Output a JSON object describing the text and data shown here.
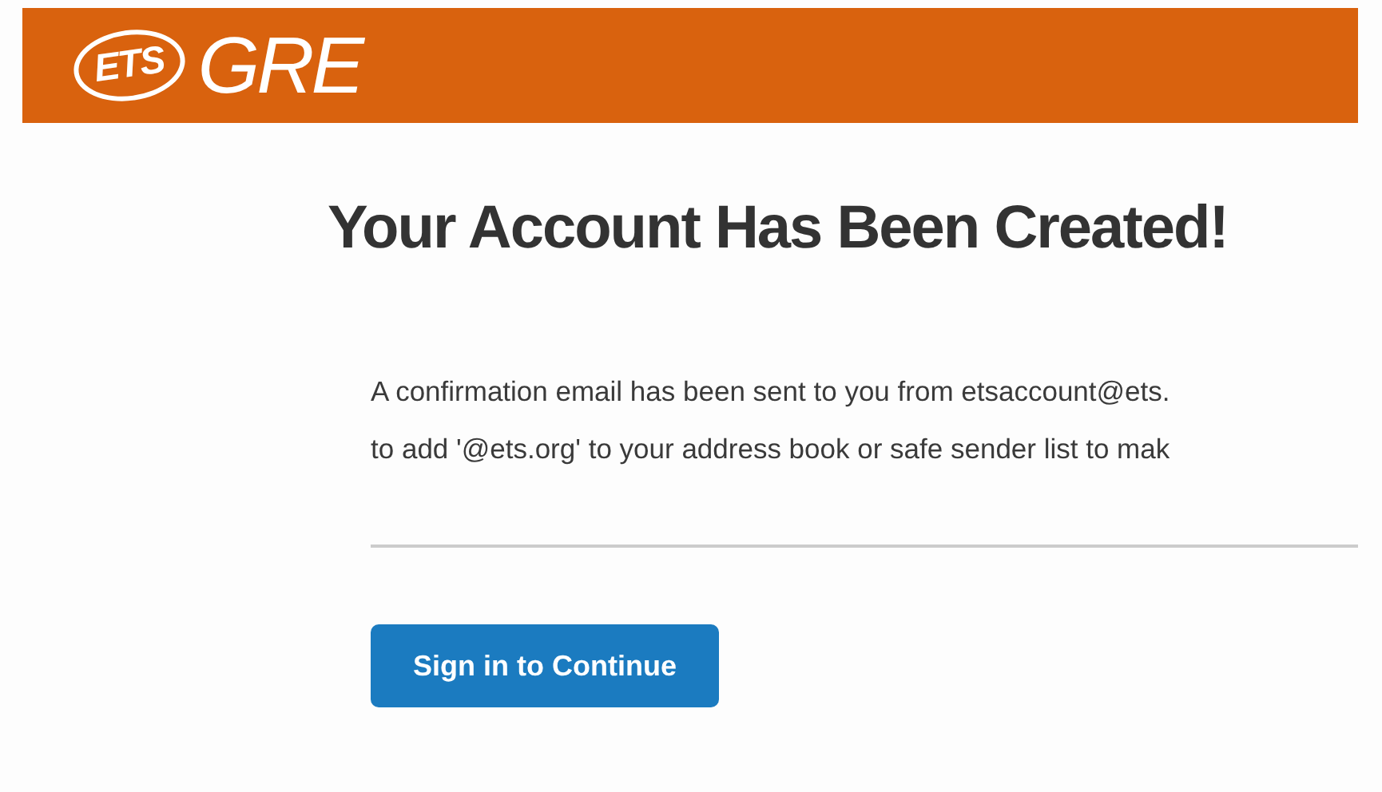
{
  "header": {
    "logo_mark": "ETS",
    "logo_name": "GRE"
  },
  "title": "Your Account Has Been Created!",
  "message_lines": [
    "A confirmation email has been sent to you from etsaccount@ets.",
    "to add '@ets.org' to your address book or safe sender list to mak"
  ],
  "button": "Sign in to Continue"
}
